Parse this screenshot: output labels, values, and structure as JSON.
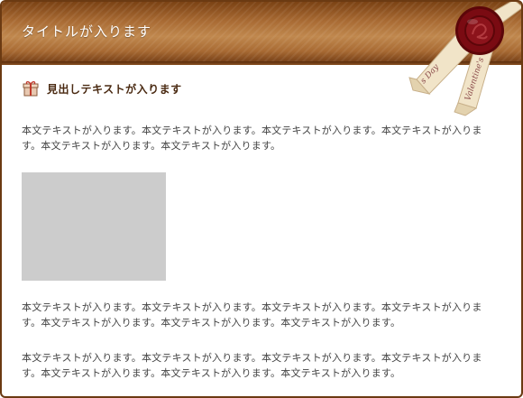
{
  "header": {
    "title": "タイトルが入ります",
    "ribbon_text_1": "Valentine's",
    "ribbon_text_2": "s Day"
  },
  "content": {
    "heading": "見出しテキストが入ります",
    "paragraph_1": "本文テキストが入ります。本文テキストが入ります。本文テキストが入ります。本文テキストが入ります。本文テキストが入ります。本文テキストが入ります。",
    "paragraph_2": "本文テキストが入ります。本文テキストが入ります。本文テキストが入ります。本文テキストが入ります。本文テキストが入ります。本文テキストが入ります。本文テキストが入ります。",
    "paragraph_3": "本文テキストが入ります。本文テキストが入ります。本文テキストが入ります。本文テキストが入ります。本文テキストが入ります。本文テキストが入ります。本文テキストが入ります。"
  },
  "colors": {
    "header_brown": "#a86a33",
    "border_brown": "#6b3a12",
    "seal_red": "#7a0b12",
    "ribbon_cream": "#f1e4c8",
    "placeholder_gray": "#cccccc"
  },
  "icons": {
    "heading_icon": "gift-icon",
    "seal": "wax-seal-icon"
  }
}
